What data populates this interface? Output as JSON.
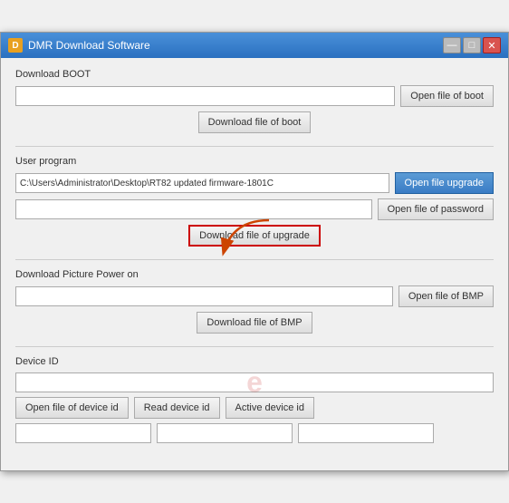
{
  "window": {
    "title": "DMR Download Software",
    "icon": "D"
  },
  "sections": {
    "boot": {
      "label": "Download BOOT",
      "input1_placeholder": "",
      "input1_value": "",
      "btn_open": "Open file of boot",
      "btn_download": "Download file of boot"
    },
    "user_program": {
      "label": "User program",
      "input_path": "C:\\Users\\Administrator\\Desktop\\RT82 updated firmware-1801C",
      "btn_open_upgrade": "Open file upgrade",
      "btn_open_password": "Open file of password",
      "btn_download": "Download file of upgrade"
    },
    "picture_power": {
      "label": "Download Picture Power on",
      "input1_placeholder": "",
      "btn_open_bmp": "Open file of BMP",
      "btn_download": "Download file of BMP"
    },
    "device_id": {
      "label": "Device ID",
      "input1_placeholder": "",
      "input2_placeholder": "",
      "input3_placeholder": "",
      "btn_open": "Open file of device id",
      "btn_read": "Read device id",
      "btn_active": "Active device id"
    }
  },
  "titlebar": {
    "min": "—",
    "max": "□",
    "close": "✕"
  }
}
